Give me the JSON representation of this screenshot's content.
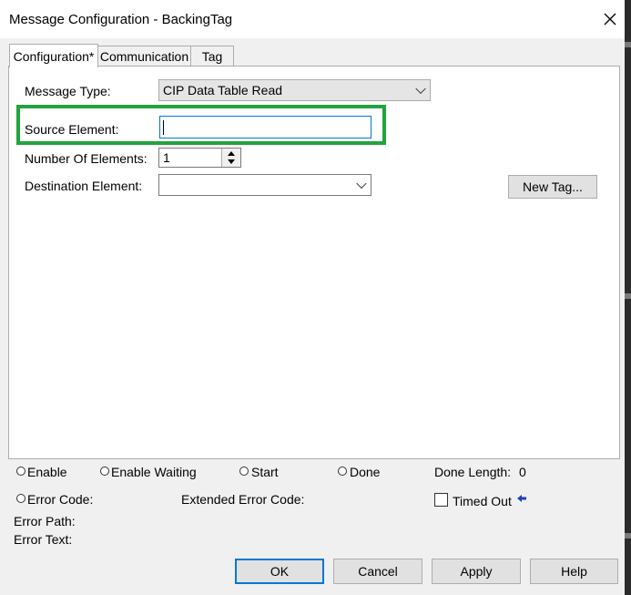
{
  "window": {
    "title": "Message Configuration - BackingTag"
  },
  "tabs": [
    {
      "label": "Configuration*",
      "active": true
    },
    {
      "label": "Communication",
      "active": false
    },
    {
      "label": "Tag",
      "active": false
    }
  ],
  "config": {
    "message_type_label": "Message Type:",
    "message_type_value": "CIP Data Table Read",
    "source_element_label": "Source Element:",
    "source_element_value": "",
    "num_elements_label": "Number Of Elements:",
    "num_elements_value": "1",
    "dest_element_label": "Destination Element:",
    "dest_element_value": "",
    "new_tag_label": "New Tag..."
  },
  "status": {
    "enable_label": "Enable",
    "enable_waiting_label": "Enable Waiting",
    "start_label": "Start",
    "done_label": "Done",
    "done_length_label": "Done Length:",
    "done_length_value": "0",
    "error_code_label": "Error Code:",
    "extended_error_code_label": "Extended Error Code:",
    "timed_out_label": "Timed Out",
    "error_path_label": "Error Path:",
    "error_text_label": "Error Text:"
  },
  "buttons": {
    "ok": "OK",
    "cancel": "Cancel",
    "apply": "Apply",
    "help": "Help"
  },
  "colors": {
    "highlight_box": "#21a33e",
    "focus_border": "#0078d7",
    "timed_out_arrow": "#1f3fbf"
  },
  "icons": {
    "close": "close-icon",
    "dropdown": "chevron-down-icon",
    "spin": "spin-arrows-icon",
    "timed_out_indicator": "arrow-left-icon"
  }
}
